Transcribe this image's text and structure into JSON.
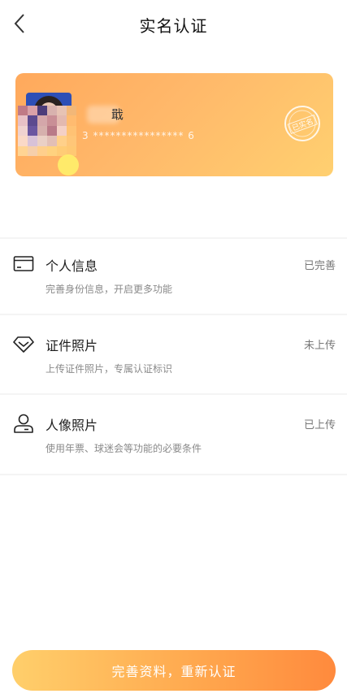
{
  "header": {
    "title": "实名认证",
    "back_icon": "chevron-left-icon"
  },
  "card": {
    "name": "戢",
    "id_number": "3 **************** 6",
    "stamp_text": "已实名",
    "gradient": [
      "#ffa95c",
      "#ffd070"
    ]
  },
  "items": [
    {
      "icon": "card-icon",
      "title": "个人信息",
      "desc": "完善身份信息，开启更多功能",
      "status": "已完善"
    },
    {
      "icon": "diamond-icon",
      "title": "证件照片",
      "desc": "上传证件照片，专属认证标识",
      "status": "未上传"
    },
    {
      "icon": "user-icon",
      "title": "人像照片",
      "desc": "使用年票、球迷会等功能的必要条件",
      "status": "已上传"
    }
  ],
  "footer": {
    "button_label": "完善资料，重新认证",
    "accent": "#ff8a3d"
  }
}
